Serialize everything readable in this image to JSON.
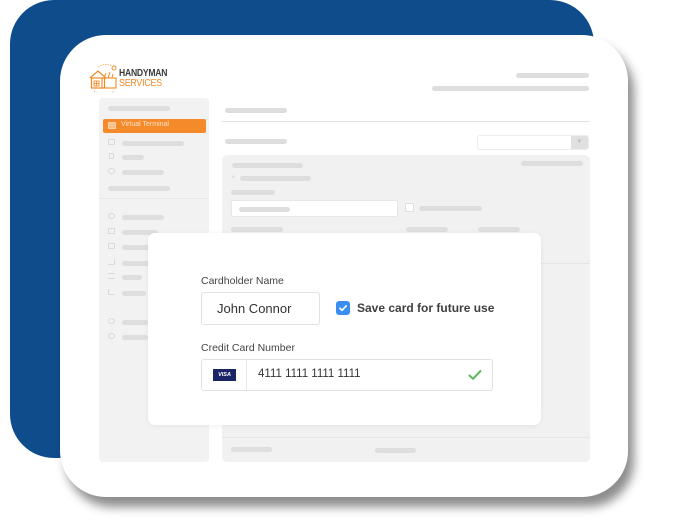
{
  "brand": {
    "name_line1": "HANDYMAN",
    "name_line2": "SERVICES",
    "accent_color": "#f08a24",
    "background_color": "#0f4c8c"
  },
  "sidebar": {
    "active_item": {
      "label": "Virtual Terminal",
      "icon": "terminal-icon"
    },
    "items": [
      {
        "icon": "document-icon"
      },
      {
        "icon": "file-icon"
      },
      {
        "icon": "link-icon"
      },
      {
        "icon": "home-icon"
      },
      {
        "icon": "card-icon"
      },
      {
        "icon": "calendar-icon"
      },
      {
        "icon": "cart-icon"
      },
      {
        "icon": "filter-icon"
      },
      {
        "icon": "chart-icon"
      },
      {
        "icon": "user-icon"
      },
      {
        "icon": "settings-icon"
      }
    ]
  },
  "payment_form": {
    "cardholder_label": "Cardholder Name",
    "cardholder_value": "John Connor",
    "save_card_label": "Save card for future use",
    "save_card_checked": true,
    "card_number_label": "Credit Card Number",
    "card_brand": "VISA",
    "card_number_value": "4111 1111 1111 1111",
    "card_valid": true,
    "checkbox_color": "#3b8ef0",
    "valid_color": "#5cb85c"
  }
}
